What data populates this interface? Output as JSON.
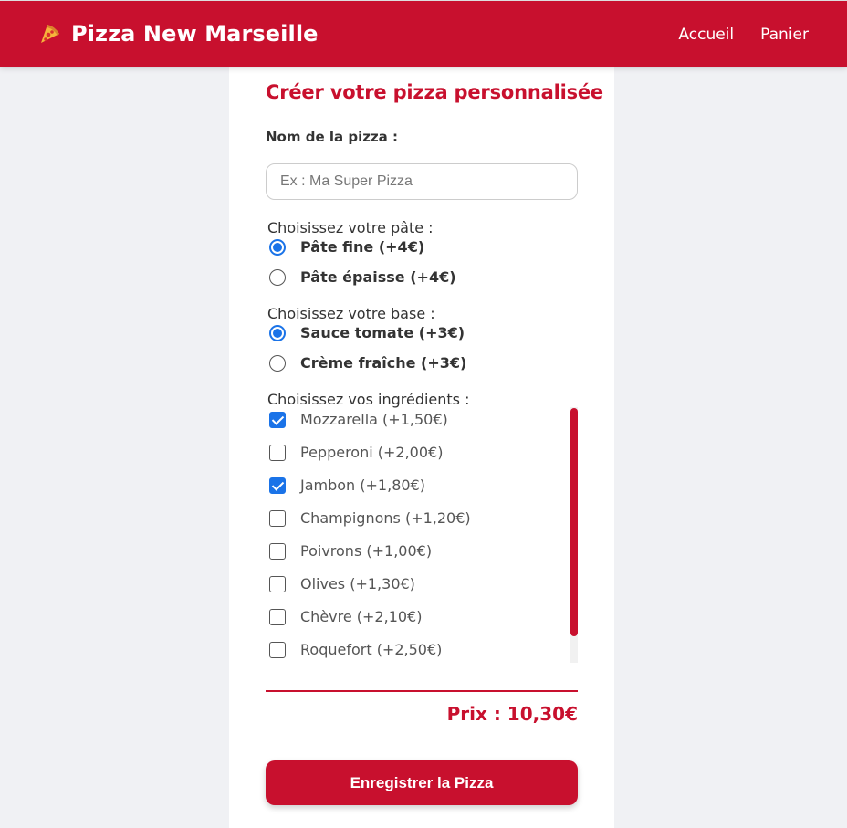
{
  "header": {
    "brand_icon": "pizza-slice-icon",
    "brand_name": "Pizza New Marseille",
    "nav": [
      "Accueil",
      "Panier"
    ]
  },
  "form": {
    "title": "Créer votre pizza personnalisée",
    "name_label": "Nom de la pizza :",
    "name_placeholder": "Ex : Ma Super Pizza",
    "name_value": "",
    "dough": {
      "label": "Choisissez votre pâte :",
      "options": [
        {
          "label": "Pâte fine (+4€)",
          "selected": true
        },
        {
          "label": "Pâte épaisse (+4€)",
          "selected": false
        }
      ]
    },
    "base": {
      "label": "Choisissez votre base :",
      "options": [
        {
          "label": "Sauce tomate (+3€)",
          "selected": true
        },
        {
          "label": "Crème fraîche (+3€)",
          "selected": false
        }
      ]
    },
    "ingredients": {
      "label": "Choisissez vos ingrédients :",
      "items": [
        {
          "label": "Mozzarella (+1,50€)",
          "checked": true
        },
        {
          "label": "Pepperoni (+2,00€)",
          "checked": false
        },
        {
          "label": "Jambon (+1,80€)",
          "checked": true
        },
        {
          "label": "Champignons (+1,20€)",
          "checked": false
        },
        {
          "label": "Poivrons (+1,00€)",
          "checked": false
        },
        {
          "label": "Olives (+1,30€)",
          "checked": false
        },
        {
          "label": "Chèvre (+2,10€)",
          "checked": false
        },
        {
          "label": "Roquefort (+2,50€)",
          "checked": false
        }
      ]
    },
    "price": "Prix : 10,30€",
    "save_label": "Enregistrer la Pizza"
  },
  "colors": {
    "brand": "#c8102e",
    "accent": "#1a73e8",
    "background": "#f0f1f4"
  }
}
